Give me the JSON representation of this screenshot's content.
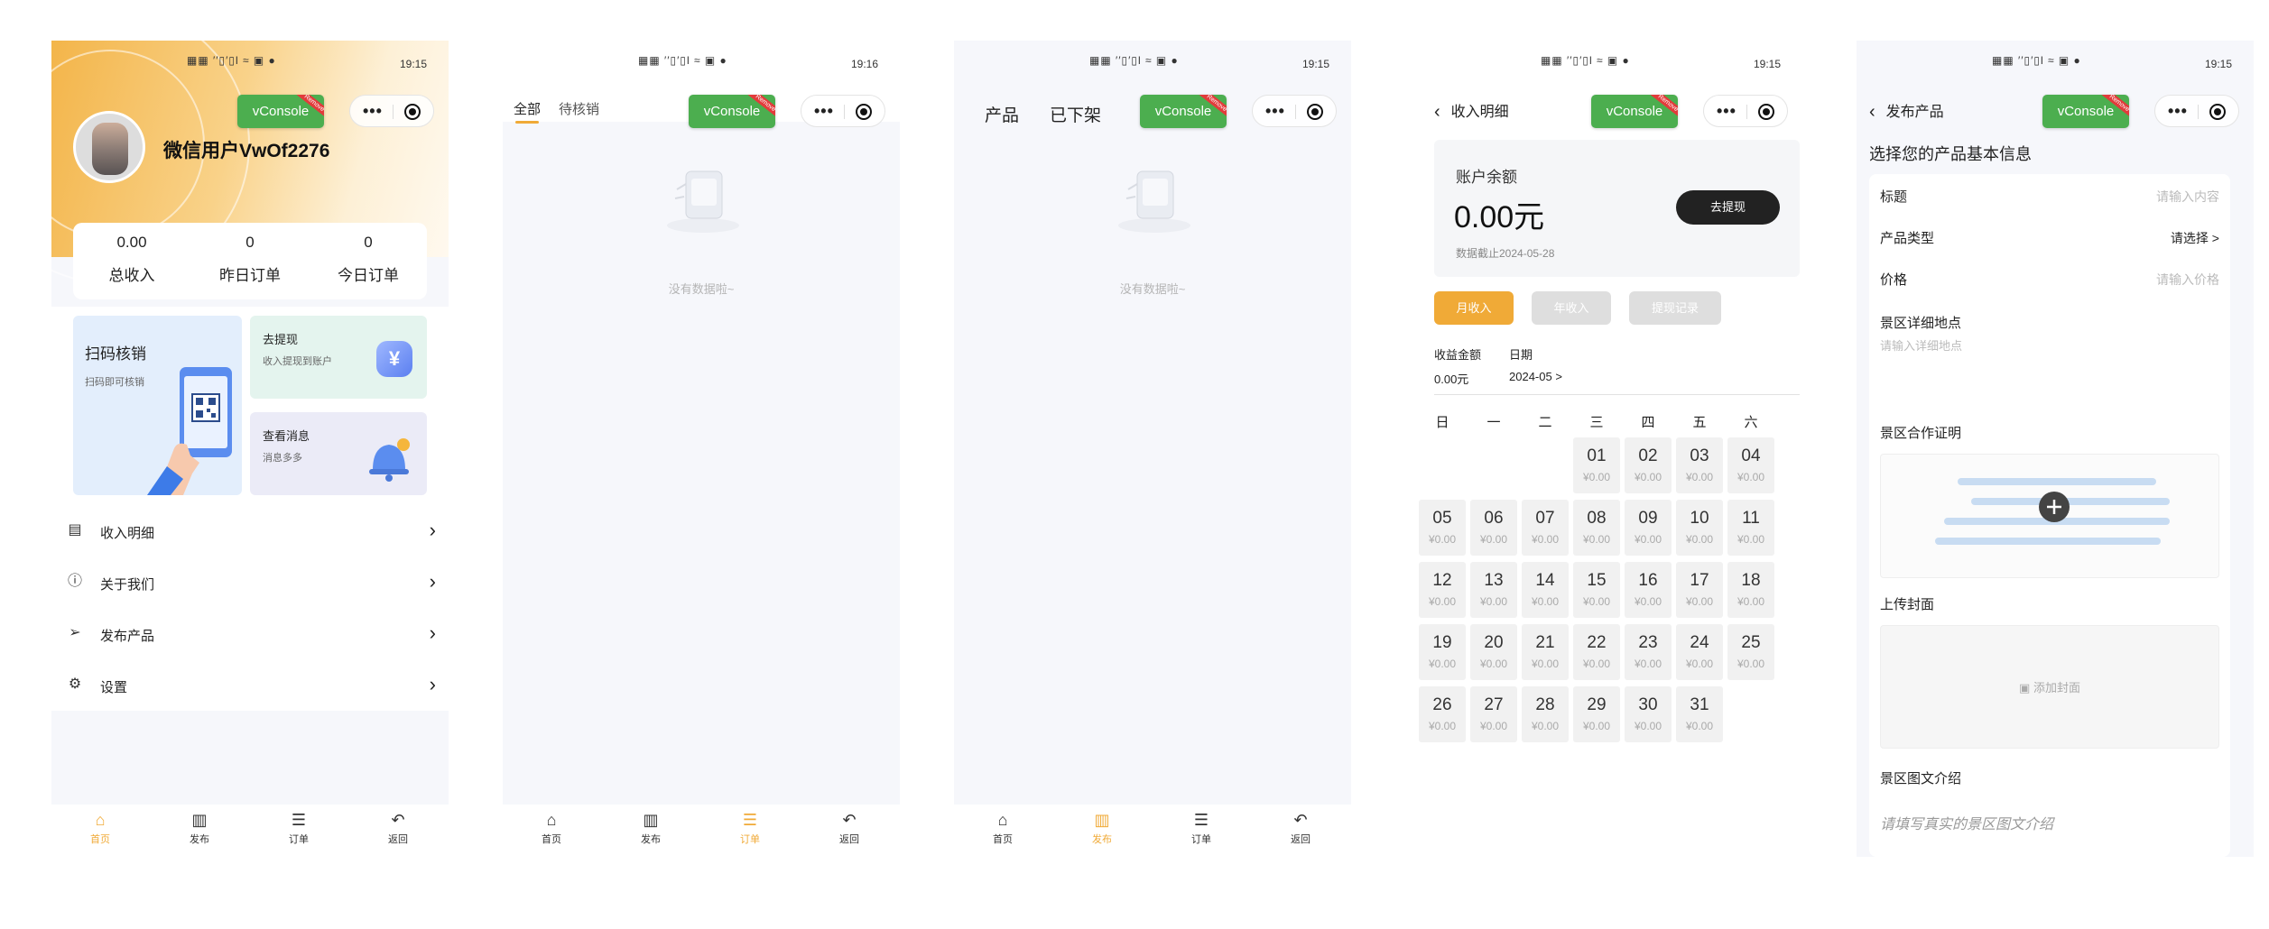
{
  "status": {
    "signal": "▦▦ ′′▯′▯l ≈ ▣ ●",
    "time_1": "19:15",
    "time_2": "19:16",
    "time_3": "19:15",
    "time_4": "19:15",
    "time_5": "19:15"
  },
  "vconsole_label": "vConsole",
  "tabbar": {
    "items": [
      "首页",
      "发布",
      "订单",
      "返回"
    ],
    "active_color": "#f0aa37"
  },
  "home": {
    "username": "微信用户VwOf2276",
    "stats": [
      {
        "value": "0.00",
        "label": "总收入"
      },
      {
        "value": "0",
        "label": "昨日订单"
      },
      {
        "value": "0",
        "label": "今日订单"
      }
    ],
    "scan_card": {
      "title": "扫码核销",
      "subtitle": "扫码即可核销"
    },
    "withdraw_card": {
      "title": "去提现",
      "subtitle": "收入提现到账户",
      "color": "#e4f4ee"
    },
    "message_card": {
      "title": "查看消息",
      "subtitle": "消息多多",
      "color": "#ebebf7"
    },
    "menu": [
      {
        "label": "收入明细",
        "icon": "receipt-icon"
      },
      {
        "label": "关于我们",
        "icon": "info-icon"
      },
      {
        "label": "发布产品",
        "icon": "send-icon"
      },
      {
        "label": "设置",
        "icon": "user-settings-icon"
      }
    ]
  },
  "orders": {
    "tabs": [
      "全部",
      "待核销"
    ],
    "empty_text": "没有数据啦~"
  },
  "products": {
    "tabs": [
      "产品",
      "已下架"
    ],
    "empty_text": "没有数据啦~"
  },
  "income": {
    "title": "收入明细",
    "balance_label": "账户余额",
    "balance_value": "0.00元",
    "balance_date": "数据截止2024-05-28",
    "withdraw_button": "去提现",
    "segments": [
      "月收入",
      "年收入",
      "提现记录"
    ],
    "income_label": "收益金额",
    "income_value": "0.00元",
    "date_label": "日期",
    "date_value": "2024-05 >",
    "weekdays": [
      "日",
      "一",
      "二",
      "三",
      "四",
      "五",
      "六"
    ],
    "first_weekday_index": 3,
    "days": [
      "01",
      "02",
      "03",
      "04",
      "05",
      "06",
      "07",
      "08",
      "09",
      "10",
      "11",
      "12",
      "13",
      "14",
      "15",
      "16",
      "17",
      "18",
      "19",
      "20",
      "21",
      "22",
      "23",
      "24",
      "25",
      "26",
      "27",
      "28",
      "29",
      "30",
      "31"
    ],
    "day_amount": "¥0.00"
  },
  "publish": {
    "title": "发布产品",
    "heading": "选择您的产品基本信息",
    "fields": [
      {
        "label": "标题",
        "value": "请输入内容"
      },
      {
        "label": "产品类型",
        "value": "请选择 >"
      },
      {
        "label": "价格",
        "value": "请输入价格"
      }
    ],
    "address_label": "景区详细地点",
    "address_placeholder": "请输入详细地点",
    "proof_label": "景区合作证明",
    "cover_label": "上传封面",
    "cover_button": "添加封面",
    "intro_label": "景区图文介绍",
    "intro_placeholder": "请填写真实的景区图文介绍"
  }
}
